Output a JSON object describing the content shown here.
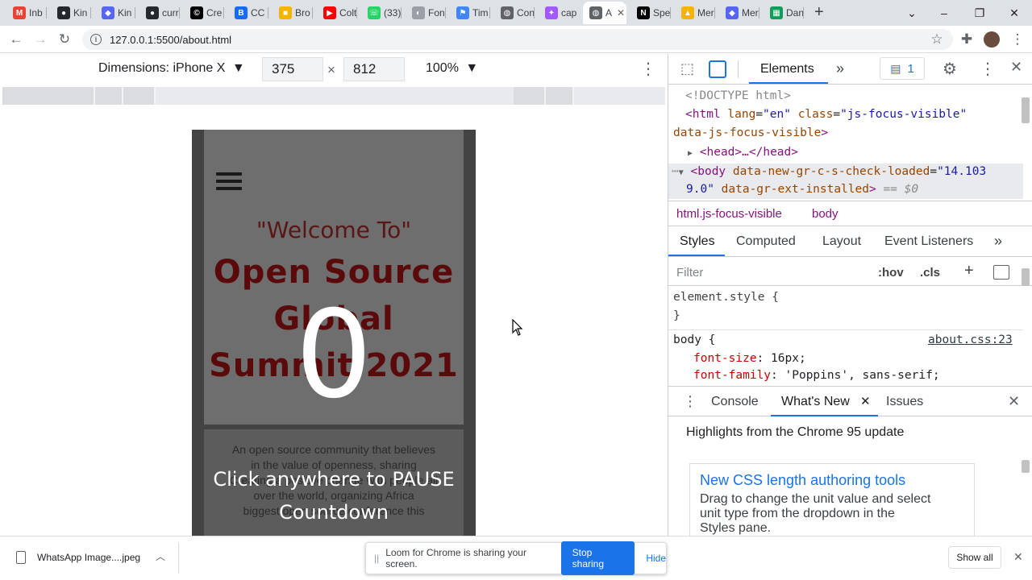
{
  "browser": {
    "tabs": [
      {
        "label": "Inb",
        "icon": "gmail-icon",
        "color": "#ea4335",
        "glyph": "M"
      },
      {
        "label": "Kin",
        "icon": "github-icon",
        "color": "#24292e",
        "glyph": "●"
      },
      {
        "label": "Kin",
        "icon": "discord-icon",
        "color": "#5865f2",
        "glyph": "◆"
      },
      {
        "label": "curr",
        "icon": "github-icon",
        "color": "#24292e",
        "glyph": "●"
      },
      {
        "label": "Cre",
        "icon": "cc-icon",
        "color": "#000000",
        "glyph": "©"
      },
      {
        "label": "CC",
        "icon": "behance-icon",
        "color": "#1769ff",
        "glyph": "B"
      },
      {
        "label": "Bro",
        "icon": "slides-icon",
        "color": "#f4b400",
        "glyph": "■"
      },
      {
        "label": "Colt",
        "icon": "youtube-icon",
        "color": "#ff0000",
        "glyph": "▶"
      },
      {
        "label": "(33)",
        "icon": "whatsapp-icon",
        "color": "#25d366",
        "glyph": "☏"
      },
      {
        "label": "Fon",
        "icon": "fonts-icon",
        "color": "#9aa0a6",
        "glyph": "◐"
      },
      {
        "label": "Tim",
        "icon": "flag-icon",
        "color": "#4285f4",
        "glyph": "⚑"
      },
      {
        "label": "Con",
        "icon": "globe-icon",
        "color": "#5f6368",
        "glyph": "◍"
      },
      {
        "label": "cap",
        "icon": "figma-icon",
        "color": "#a259ff",
        "glyph": "✦"
      },
      {
        "label": "A",
        "icon": "globe-icon",
        "color": "#5f6368",
        "glyph": "◍",
        "active": true
      },
      {
        "label": "Spe",
        "icon": "notion-icon",
        "color": "#000000",
        "glyph": "N"
      },
      {
        "label": "Mer",
        "icon": "gdrive-icon",
        "color": "#f4b400",
        "glyph": "▲"
      },
      {
        "label": "Mer",
        "icon": "discord-icon",
        "color": "#5865f2",
        "glyph": "◆"
      },
      {
        "label": "Dan",
        "icon": "sheets-icon",
        "color": "#0f9d58",
        "glyph": "▦"
      }
    ],
    "new_tab_glyph": "+",
    "url": "127.0.0.1:5500/about.html"
  },
  "device_toolbar": {
    "dimensions_label": "Dimensions: iPhone X",
    "width": "375",
    "height": "812",
    "times": "×",
    "zoom": "100%"
  },
  "page": {
    "welcome": "\"Welcome To\"",
    "title_lines": [
      "Open Source",
      "Global",
      "Summit 2021"
    ],
    "countdown": "0",
    "desc_lines": [
      "An open source community that believes",
      "in the value of openness, sharing",
      "Creating a positive change with people all",
      "over the world, organizing Africa",
      "biggest open source conference this"
    ],
    "pause_lines": [
      "Click anywhere to PAUSE",
      "Countdown"
    ]
  },
  "devtools": {
    "main_tab": "Elements",
    "more": "»",
    "issues_count": "1",
    "dom_lines": {
      "doctype": "<!DOCTYPE html>",
      "html_open_tag": "<html",
      "html_lang_attr": " lang",
      "html_lang_val": "\"en\"",
      "html_class_attr": " class",
      "html_class_val": "\"js-focus-visible\"",
      "html_line2": "data-js-focus-visible",
      "head": "<head>…</head>",
      "body_tag": "<body",
      "body_attr1": " data-new-gr-c-s-check-loaded",
      "body_val1a": "\"14.103",
      "body_val1b": "9.0\"",
      "body_attr2": " data-gr-ext-installed",
      "body_suffix": " == $0"
    },
    "breadcrumbs": [
      "html.js-focus-visible",
      "body"
    ],
    "style_tabs": [
      "Styles",
      "Computed",
      "Layout",
      "Event Listeners"
    ],
    "filter_placeholder": "Filter",
    "hov": ":hov",
    "cls": ".cls",
    "element_style": "element.style {",
    "close_brace": "}",
    "body_rule": "body {",
    "body_rule_source": "about.css:23",
    "rules": [
      {
        "prop": "font-size",
        "value": "16px;"
      },
      {
        "prop": "font-family",
        "value": "'Poppins', sans-serif;"
      }
    ],
    "drawer_tabs": [
      "Console",
      "What's New",
      "Issues"
    ],
    "whats_new_heading": "Highlights from the Chrome 95 update",
    "card_title": "New CSS length authoring tools",
    "card_body_lines": [
      "Drag to change the unit value and select",
      "unit type from the dropdown in the",
      "Styles pane."
    ]
  },
  "downloads": {
    "file": "WhatsApp Image....jpeg",
    "show_all": "Show all"
  },
  "loom": {
    "message": "Loom for Chrome is sharing your screen.",
    "stop": "Stop sharing",
    "hide": "Hide"
  }
}
